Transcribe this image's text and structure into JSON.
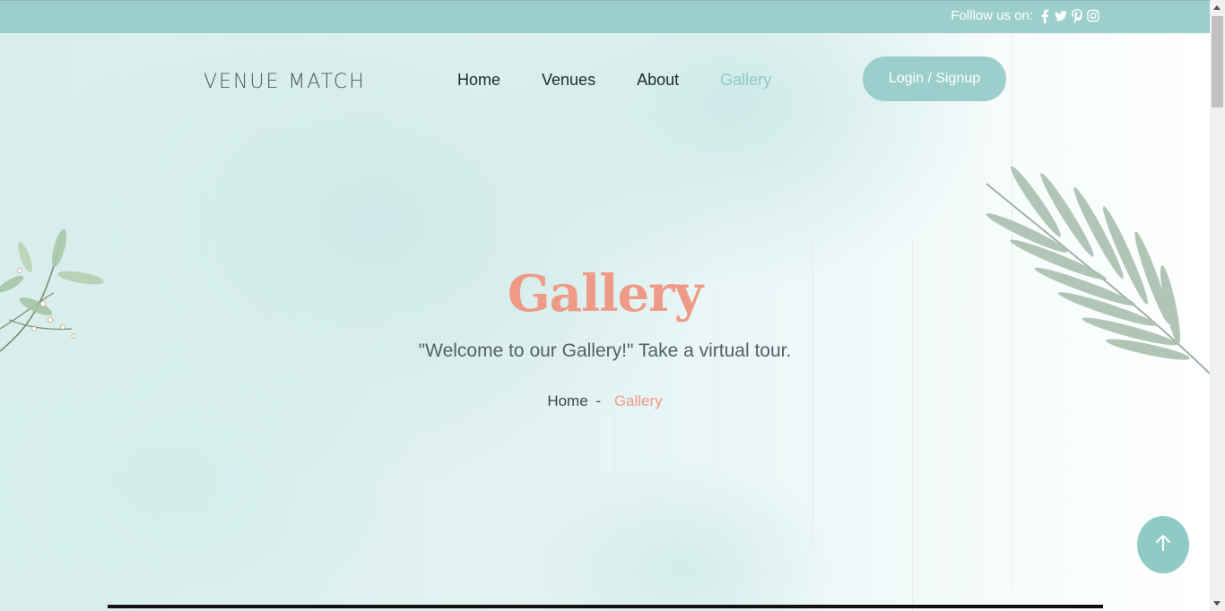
{
  "topbar": {
    "follow_label": "Folllow us on:",
    "social_icons": [
      "facebook-icon",
      "twitter-icon",
      "pinterest-icon",
      "instagram-icon"
    ]
  },
  "header": {
    "logo": "VENUE MATCH",
    "nav": [
      {
        "label": "Home",
        "active": false
      },
      {
        "label": "Venues",
        "active": false
      },
      {
        "label": "About",
        "active": false
      },
      {
        "label": "Gallery",
        "active": true
      }
    ],
    "login_label": "Login / Signup"
  },
  "hero": {
    "title": "Gallery",
    "subtitle": "\"Welcome to our Gallery!\" Take a virtual tour.",
    "breadcrumb": {
      "home": "Home",
      "separator": "-",
      "current": "Gallery"
    }
  },
  "scroll_top_icon": "arrow-up-icon",
  "colors": {
    "accent": "#9ccfcb",
    "title": "#ee9a86",
    "nav_active": "#8fc9c3"
  }
}
